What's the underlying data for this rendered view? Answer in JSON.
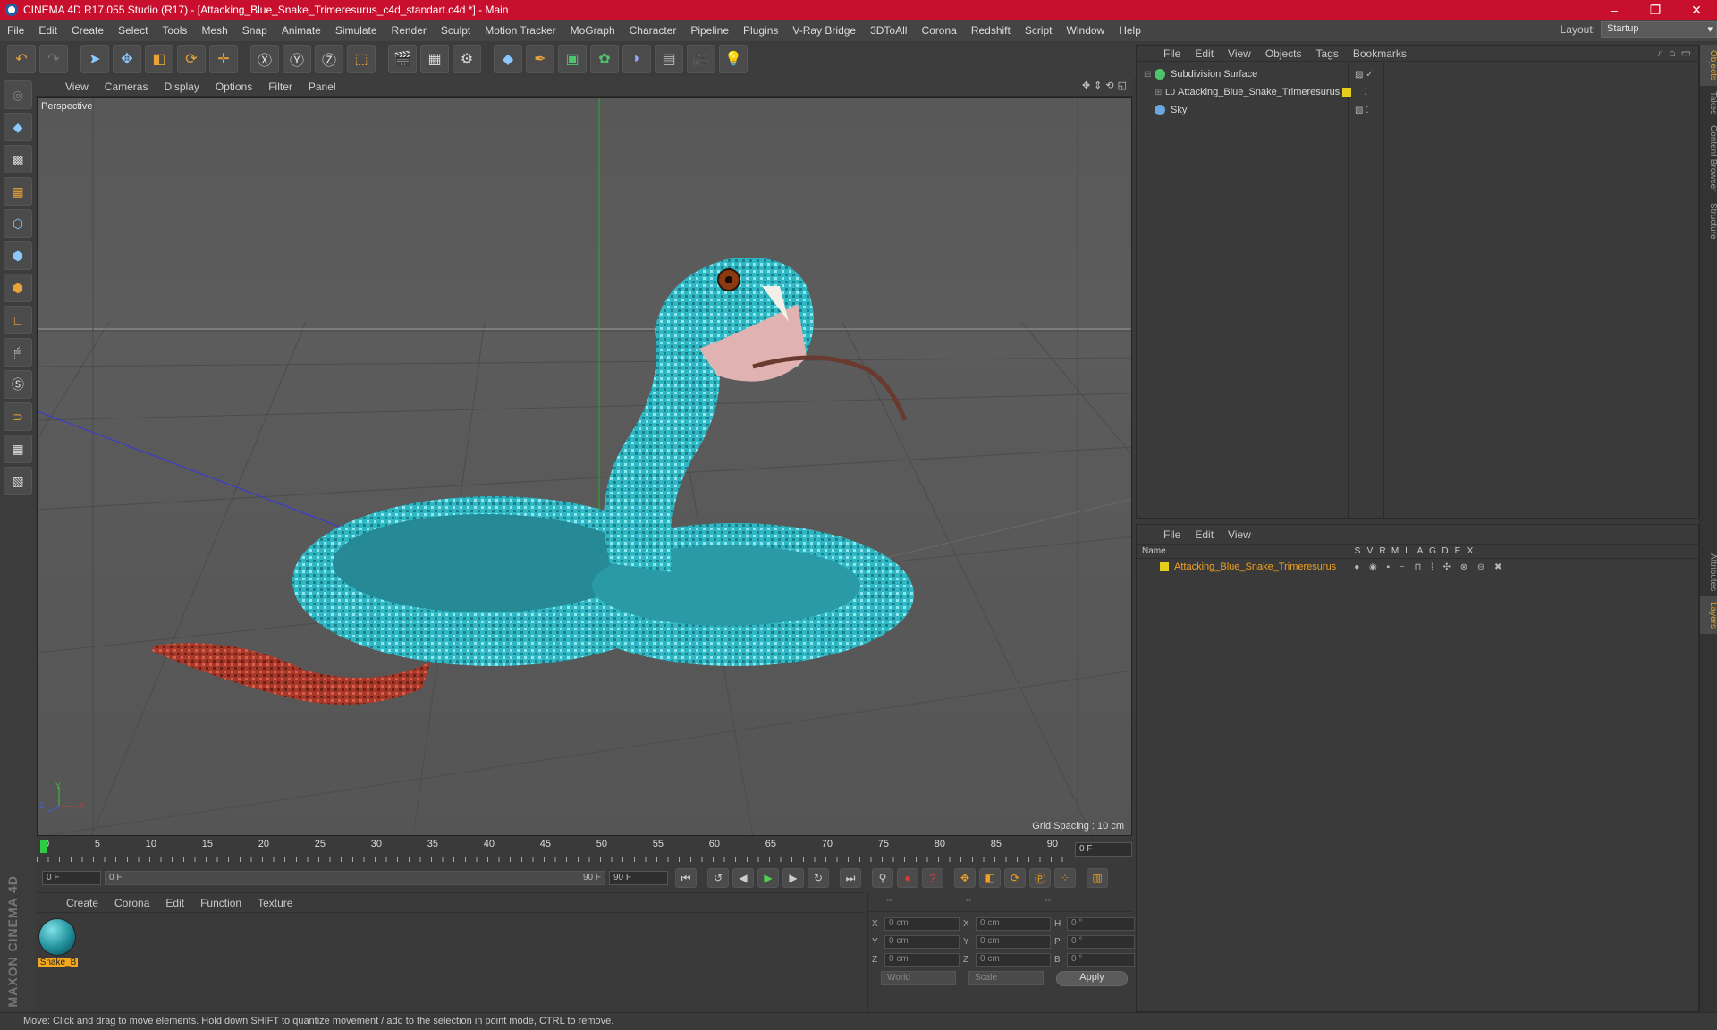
{
  "window": {
    "title": "CINEMA 4D R17.055 Studio (R17) - [Attacking_Blue_Snake_Trimeresurus_c4d_standart.c4d *] - Main",
    "controls": [
      "–",
      "❐",
      "✕"
    ]
  },
  "menubar": {
    "items": [
      "File",
      "Edit",
      "Create",
      "Select",
      "Tools",
      "Mesh",
      "Snap",
      "Animate",
      "Simulate",
      "Render",
      "Sculpt",
      "Motion Tracker",
      "MoGraph",
      "Character",
      "Pipeline",
      "Plugins",
      "V-Ray Bridge",
      "3DToAll",
      "Corona",
      "Redshift",
      "Script",
      "Window",
      "Help"
    ],
    "layout_label": "Layout:",
    "layout_value": "Startup"
  },
  "viewport": {
    "menu": [
      "View",
      "Cameras",
      "Display",
      "Options",
      "Filter",
      "Panel"
    ],
    "camera_label": "Perspective",
    "grid_spacing": "Grid Spacing : 10 cm",
    "axis_y": "Y",
    "axis_z": "Z",
    "axis_x": "X"
  },
  "timeline": {
    "ticks": [
      "0",
      "5",
      "10",
      "15",
      "20",
      "25",
      "30",
      "35",
      "40",
      "45",
      "50",
      "55",
      "60",
      "65",
      "70",
      "75",
      "80",
      "85",
      "90"
    ],
    "current_frame": "0 F"
  },
  "playbar": {
    "start": "0 F",
    "range_start": "0 F",
    "range_end": "90 F",
    "end": "90 F"
  },
  "material_manager": {
    "menu": [
      "Create",
      "Corona",
      "Edit",
      "Function",
      "Texture"
    ],
    "materials": [
      {
        "name": "Snake_B"
      }
    ]
  },
  "coordinates": {
    "header": [
      "--",
      "--",
      "--"
    ],
    "rows": [
      {
        "a1": "X",
        "v1": "0 cm",
        "a2": "X",
        "v2": "0 cm",
        "a3": "H",
        "v3": "0 °"
      },
      {
        "a1": "Y",
        "v1": "0 cm",
        "a2": "Y",
        "v2": "0 cm",
        "a3": "P",
        "v3": "0 °"
      },
      {
        "a1": "Z",
        "v1": "0 cm",
        "a2": "Z",
        "v2": "0 cm",
        "a3": "B",
        "v3": "0 °"
      }
    ],
    "mode_world": "World",
    "mode_scale": "Scale",
    "apply": "Apply"
  },
  "object_manager": {
    "menu": [
      "File",
      "Edit",
      "View",
      "Objects",
      "Tags",
      "Bookmarks"
    ],
    "objects": [
      {
        "name": "Subdivision Surface",
        "icon_color": "#4fc46a"
      },
      {
        "name": "Attacking_Blue_Snake_Trimeresurus",
        "icon_color": "#e6cf1a"
      },
      {
        "name": "Sky",
        "icon_color": "#6aa6e0"
      }
    ]
  },
  "layer_manager": {
    "menu": [
      "File",
      "Edit",
      "View"
    ],
    "columns": [
      "Name",
      "S",
      "V",
      "R",
      "M",
      "L",
      "A",
      "G",
      "D",
      "E",
      "X"
    ],
    "layers": [
      {
        "name": "Attacking_Blue_Snake_Trimeresurus",
        "color": "#e6cf1a"
      }
    ]
  },
  "side_tabs": [
    "Objects",
    "Takes",
    "Content Browser",
    "Structure",
    "Attributes",
    "Layers"
  ],
  "status": "Move: Click and drag to move elements. Hold down SHIFT to quantize movement / add to the selection in point mode, CTRL to remove.",
  "brand": "MAXON CINEMA 4D",
  "colors": {
    "accent": "#f0a020",
    "title_bar": "#c8102e",
    "snake": "#2fb8c4"
  }
}
